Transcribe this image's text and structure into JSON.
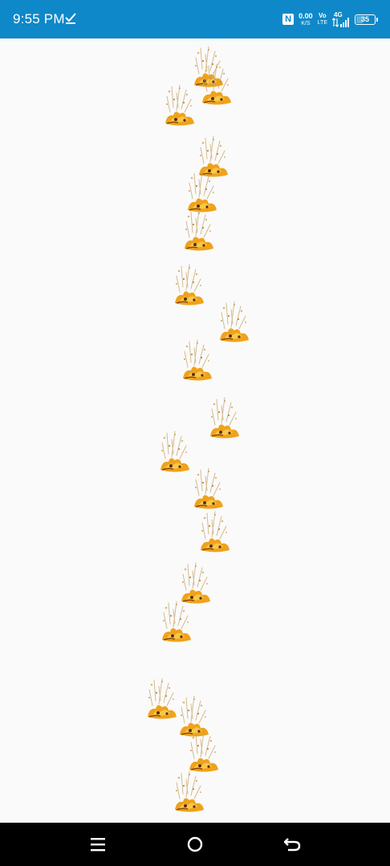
{
  "status_bar": {
    "time": "9:55 PM",
    "nfc_letter": "N",
    "net_speed_value": "0.00",
    "net_speed_unit": "K/S",
    "volte_top": "Vo",
    "volte_bottom": "LTE",
    "network_type": "4G",
    "battery_level": "35",
    "colors": {
      "background": "#0e88c8",
      "foreground": "#ffffff"
    }
  },
  "canvas": {
    "background": "#fafafa",
    "sprite_name": "falling-flame-particle",
    "sprite_count": 21
  },
  "nav_bar": {
    "buttons": [
      {
        "name": "recent-apps-button",
        "icon": "menu-lines-icon"
      },
      {
        "name": "home-button",
        "icon": "circle-icon"
      },
      {
        "name": "back-button",
        "icon": "back-arrow-icon"
      }
    ]
  }
}
